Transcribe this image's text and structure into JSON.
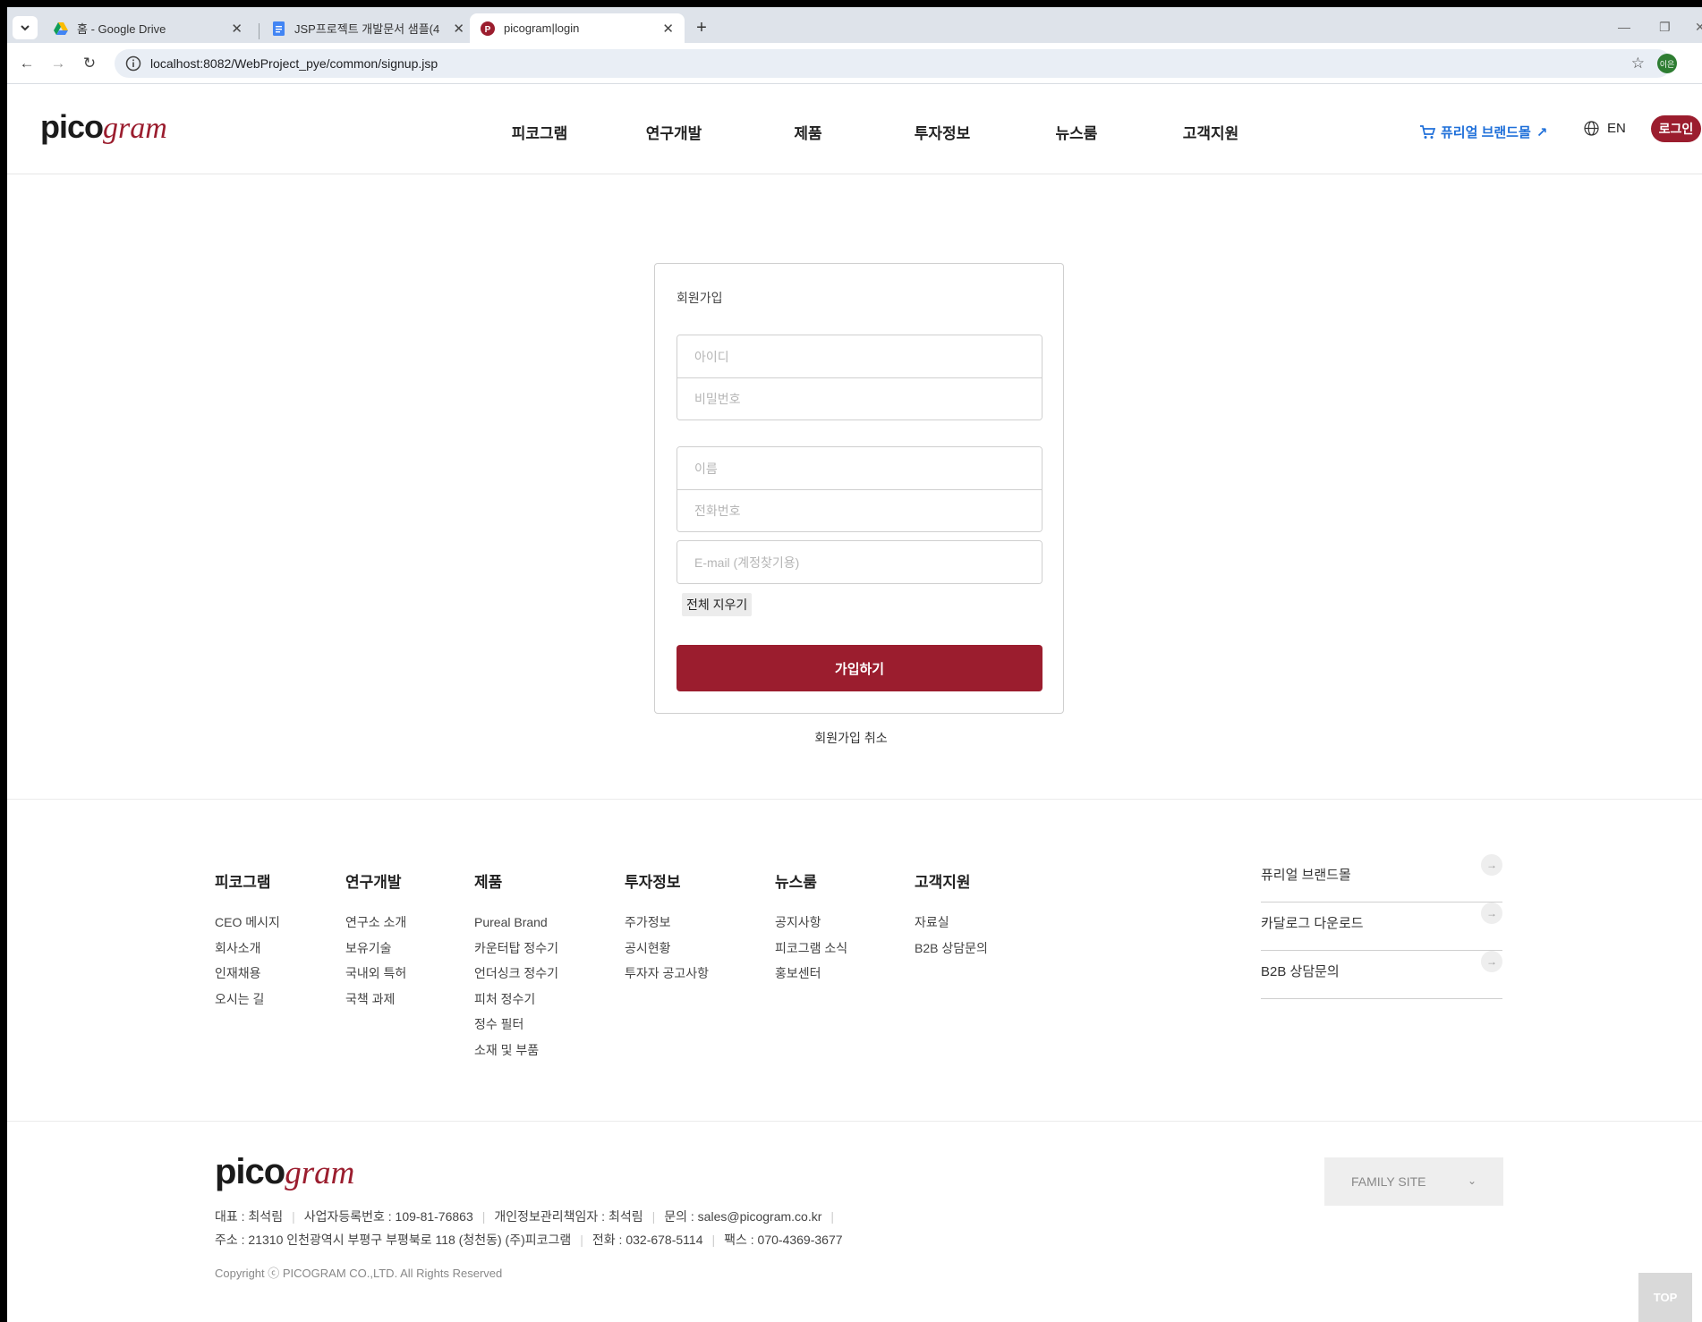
{
  "browser": {
    "tabs": [
      {
        "title": "홈 - Google Drive",
        "icon": "google-drive-icon"
      },
      {
        "title": "JSP프로젝트 개발문서 샘플(4",
        "icon": "google-docs-icon"
      },
      {
        "title": "picogram|login",
        "icon": "picogram-favicon",
        "active": true
      }
    ],
    "new_tab": "+",
    "url": "localhost:8082/WebProject_pye/common/signup.jsp",
    "profile_initials": "이은"
  },
  "site": {
    "logo": {
      "part1": "pico",
      "part2": "gram"
    },
    "nav": [
      "피코그램",
      "연구개발",
      "제품",
      "투자정보",
      "뉴스룸",
      "고객지원"
    ],
    "brand_mall": "퓨리얼 브랜드몰",
    "brand_arrow": "↗",
    "lang": "EN",
    "login": "로그인"
  },
  "signup": {
    "title": "회원가입",
    "fields": {
      "id": "아이디",
      "password": "비밀번호",
      "name": "이름",
      "phone": "전화번호",
      "email": "E-mail (계정찾기용)"
    },
    "clear": "전체 지우기",
    "submit": "가입하기",
    "cancel": "회원가입 취소"
  },
  "footer": {
    "columns": [
      {
        "title": "피코그램",
        "items": [
          "CEO 메시지",
          "회사소개",
          "인재채용",
          "오시는 길"
        ]
      },
      {
        "title": "연구개발",
        "items": [
          "연구소 소개",
          "보유기술",
          "국내외 특허",
          "국책 과제"
        ]
      },
      {
        "title": "제품",
        "items": [
          "Pureal Brand",
          "카운터탑 정수기",
          "언더싱크 정수기",
          "피처 정수기",
          "정수 필터",
          "소재 및 부품"
        ]
      },
      {
        "title": "투자정보",
        "items": [
          "주가정보",
          "공시현황",
          "투자자 공고사항"
        ]
      },
      {
        "title": "뉴스룸",
        "items": [
          "공지사항",
          "피코그램 소식",
          "홍보센터"
        ]
      },
      {
        "title": "고객지원",
        "items": [
          "자료실",
          "B2B 상담문의"
        ]
      }
    ],
    "quick_links": [
      "퓨리얼 브랜드몰",
      "카달로그 다운로드",
      "B2B 상담문의"
    ],
    "business_info": {
      "ceo": "대표 : 최석림",
      "reg_no": "사업자등록번호 : 109-81-76863",
      "privacy_officer": "개인정보관리책임자 : 최석림",
      "contact": "문의 : sales@picogram.co.kr",
      "address": "주소 : 21310 인천광역시 부평구 부평북로 118 (청천동) (주)피코그램",
      "phone": "전화 : 032-678-5114",
      "fax": "팩스 : 070-4369-3677"
    },
    "copyright": "Copyright ⓒ PICOGRAM CO.,LTD. All Rights Reserved",
    "family_site": "FAMILY SITE",
    "top": "TOP"
  }
}
